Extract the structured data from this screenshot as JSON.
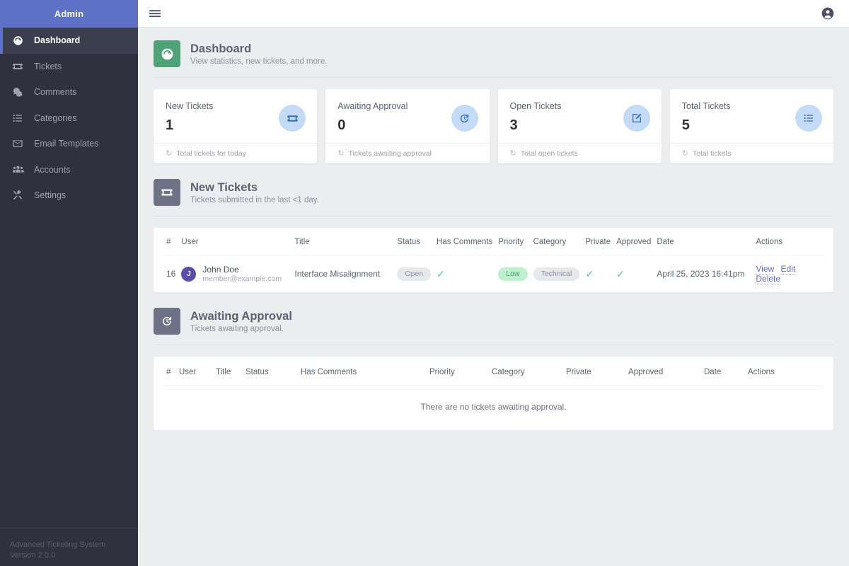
{
  "sidebar": {
    "brand": "Admin",
    "items": [
      {
        "label": "Dashboard",
        "icon": "speedometer-icon",
        "active": true
      },
      {
        "label": "Tickets",
        "icon": "ticket-icon",
        "active": false
      },
      {
        "label": "Comments",
        "icon": "comments-icon",
        "active": false
      },
      {
        "label": "Categories",
        "icon": "list-icon",
        "active": false
      },
      {
        "label": "Email Templates",
        "icon": "envelope-icon",
        "active": false
      },
      {
        "label": "Accounts",
        "icon": "users-icon",
        "active": false
      },
      {
        "label": "Settings",
        "icon": "tools-icon",
        "active": false
      }
    ],
    "footer": {
      "app_name": "Advanced Ticketing System",
      "version": "Version 2.0.0"
    }
  },
  "topbar": {
    "menu_icon": "hamburger-icon",
    "account_icon": "account-circle-icon"
  },
  "page": {
    "title": "Dashboard",
    "subtitle": "View statistics, new tickets, and more.",
    "icon": "speedometer-icon",
    "icon_color": "#4da375"
  },
  "stats": [
    {
      "label": "New Tickets",
      "value": "1",
      "footer": "Total tickets for today",
      "icon": "ticket-icon"
    },
    {
      "label": "Awaiting Approval",
      "value": "0",
      "footer": "Tickets awaiting approval",
      "icon": "history-icon"
    },
    {
      "label": "Open Tickets",
      "value": "3",
      "footer": "Total open tickets",
      "icon": "edit-icon"
    },
    {
      "label": "Total Tickets",
      "value": "5",
      "footer": "Total tickets",
      "icon": "list-icon"
    }
  ],
  "new_tickets": {
    "title": "New Tickets",
    "subtitle": "Tickets submitted in the last <1 day.",
    "icon": "ticket-icon",
    "icon_color": "#6d7287",
    "columns": [
      "#",
      "User",
      "Title",
      "Status",
      "Has Comments",
      "Priority",
      "Category",
      "Private",
      "Approved",
      "Date",
      "Actions"
    ],
    "rows": [
      {
        "id": "16",
        "avatar_initial": "J",
        "avatar_color": "#5b4ea8",
        "user_name": "John Doe",
        "user_email": "member@example.com",
        "title": "Interface Misalignment",
        "status": "Open",
        "has_comments": "✓",
        "priority": "Low",
        "category": "Technical",
        "private": "✓",
        "approved": "✓",
        "date": "April 25, 2023 16:41pm",
        "actions": [
          "View",
          "Edit",
          "Delete"
        ]
      }
    ]
  },
  "awaiting_approval": {
    "title": "Awaiting Approval",
    "subtitle": "Tickets awaiting approval.",
    "icon": "history-icon",
    "icon_color": "#6d7287",
    "columns": [
      "#",
      "User",
      "Title",
      "Status",
      "Has Comments",
      "Priority",
      "Category",
      "Private",
      "Approved",
      "Date",
      "Actions"
    ],
    "empty_message": "There are no tickets awaiting approval."
  },
  "colors": {
    "sidebar_bg": "#2f323e",
    "brand_bg": "#5d72c4",
    "accent": "#5d72c4",
    "content_bg": "#ebedef",
    "green_icon": "#4da375",
    "slate_icon": "#6d7287",
    "card_circle": "#c3dbf7"
  }
}
